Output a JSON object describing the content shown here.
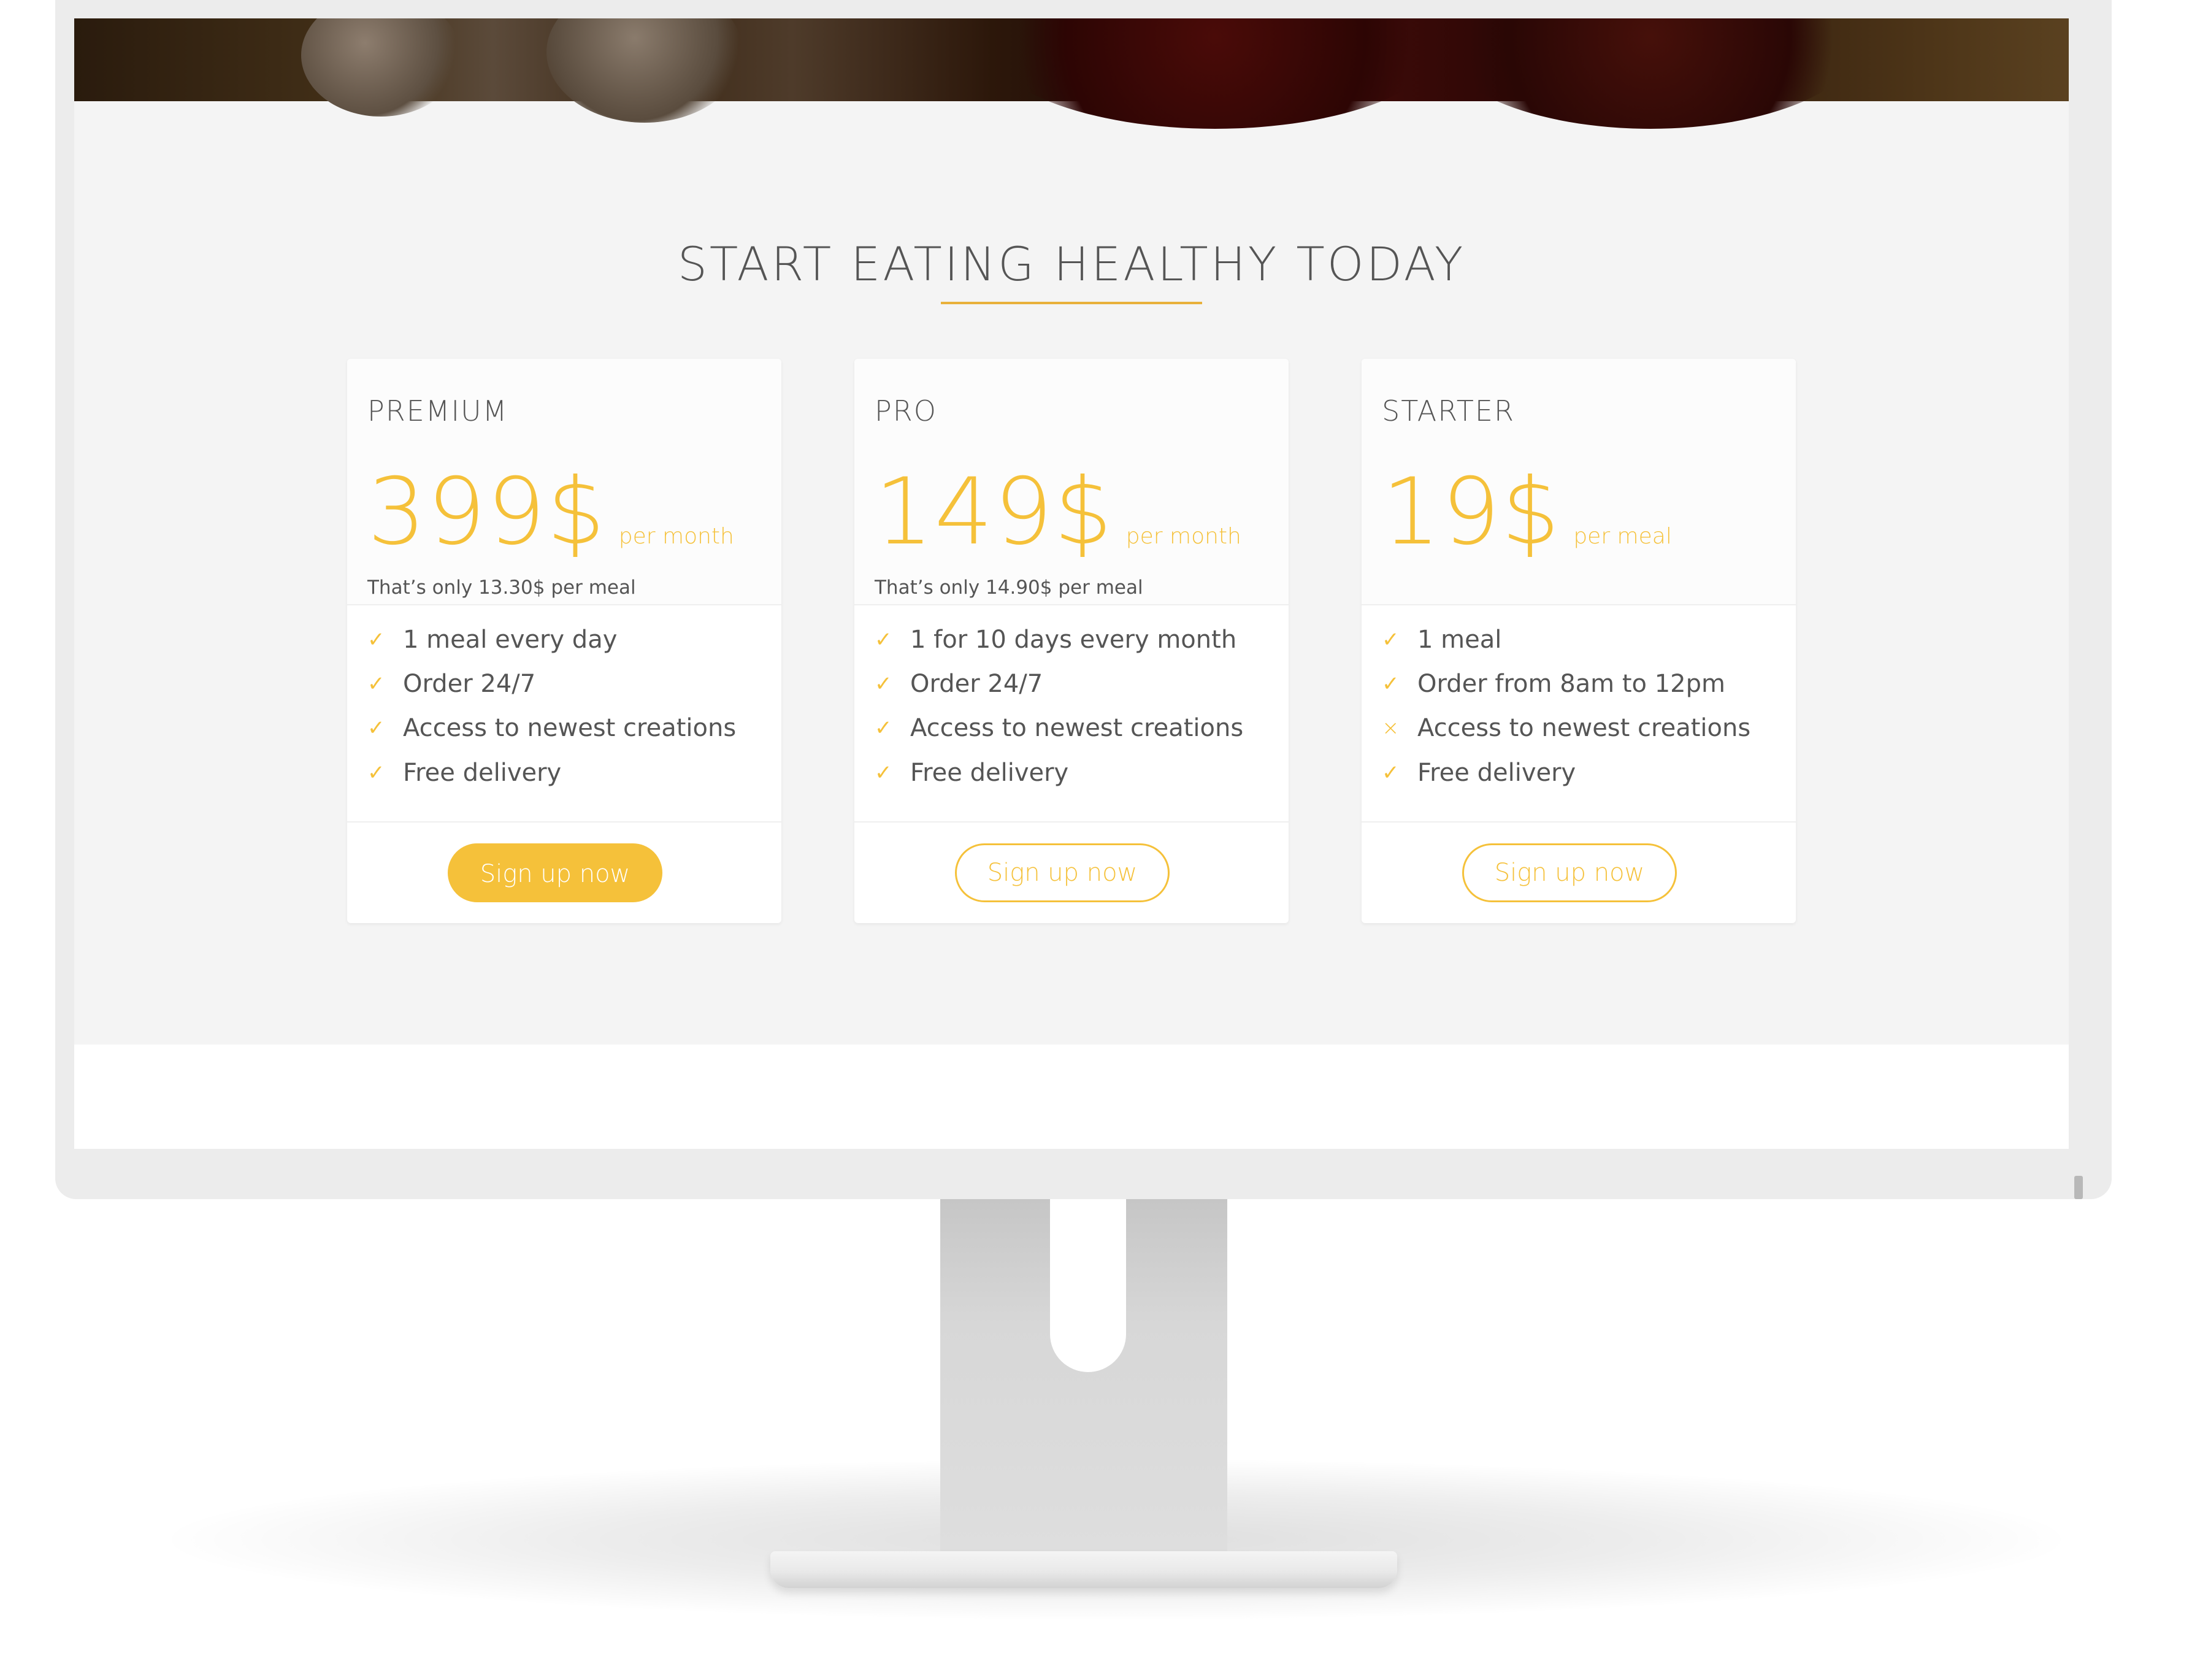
{
  "section": {
    "title": "START EATING HEALTHY TODAY"
  },
  "plans": [
    {
      "name": "PREMIUM",
      "price": "399$",
      "unit": "per month",
      "subtext": "That’s only 13.30$ per meal",
      "features": [
        {
          "icon": "check-icon",
          "text": "1 meal every day"
        },
        {
          "icon": "check-icon",
          "text": "Order 24/7"
        },
        {
          "icon": "check-icon",
          "text": "Access to newest creations"
        },
        {
          "icon": "check-icon",
          "text": "Free delivery"
        }
      ],
      "cta": "Sign up now",
      "cta_style": "solid"
    },
    {
      "name": "PRO",
      "price": "149$",
      "unit": "per month",
      "subtext": "That’s only 14.90$ per meal",
      "features": [
        {
          "icon": "check-icon",
          "text": "1 for 10 days every month"
        },
        {
          "icon": "check-icon",
          "text": "Order 24/7"
        },
        {
          "icon": "check-icon",
          "text": "Access to newest creations"
        },
        {
          "icon": "check-icon",
          "text": "Free delivery"
        }
      ],
      "cta": "Sign up now",
      "cta_style": "ghost"
    },
    {
      "name": "STARTER",
      "price": "19$",
      "unit": "per meal",
      "subtext": "",
      "features": [
        {
          "icon": "check-icon",
          "text": "1 meal"
        },
        {
          "icon": "check-icon",
          "text": "Order from 8am to 12pm"
        },
        {
          "icon": "cross-icon",
          "text": "Access to newest creations"
        },
        {
          "icon": "check-icon",
          "text": "Free delivery"
        }
      ],
      "cta": "Sign up now",
      "cta_style": "ghost"
    }
  ],
  "colors": {
    "accent": "#f5c13a",
    "text": "#555555",
    "section_bg": "#f4f4f4",
    "card_bg": "#ffffff"
  },
  "icons": {
    "check-icon": "✓",
    "cross-icon": "×",
    "scroll-up-icon": "▲",
    "scroll-down-icon": "▼"
  }
}
